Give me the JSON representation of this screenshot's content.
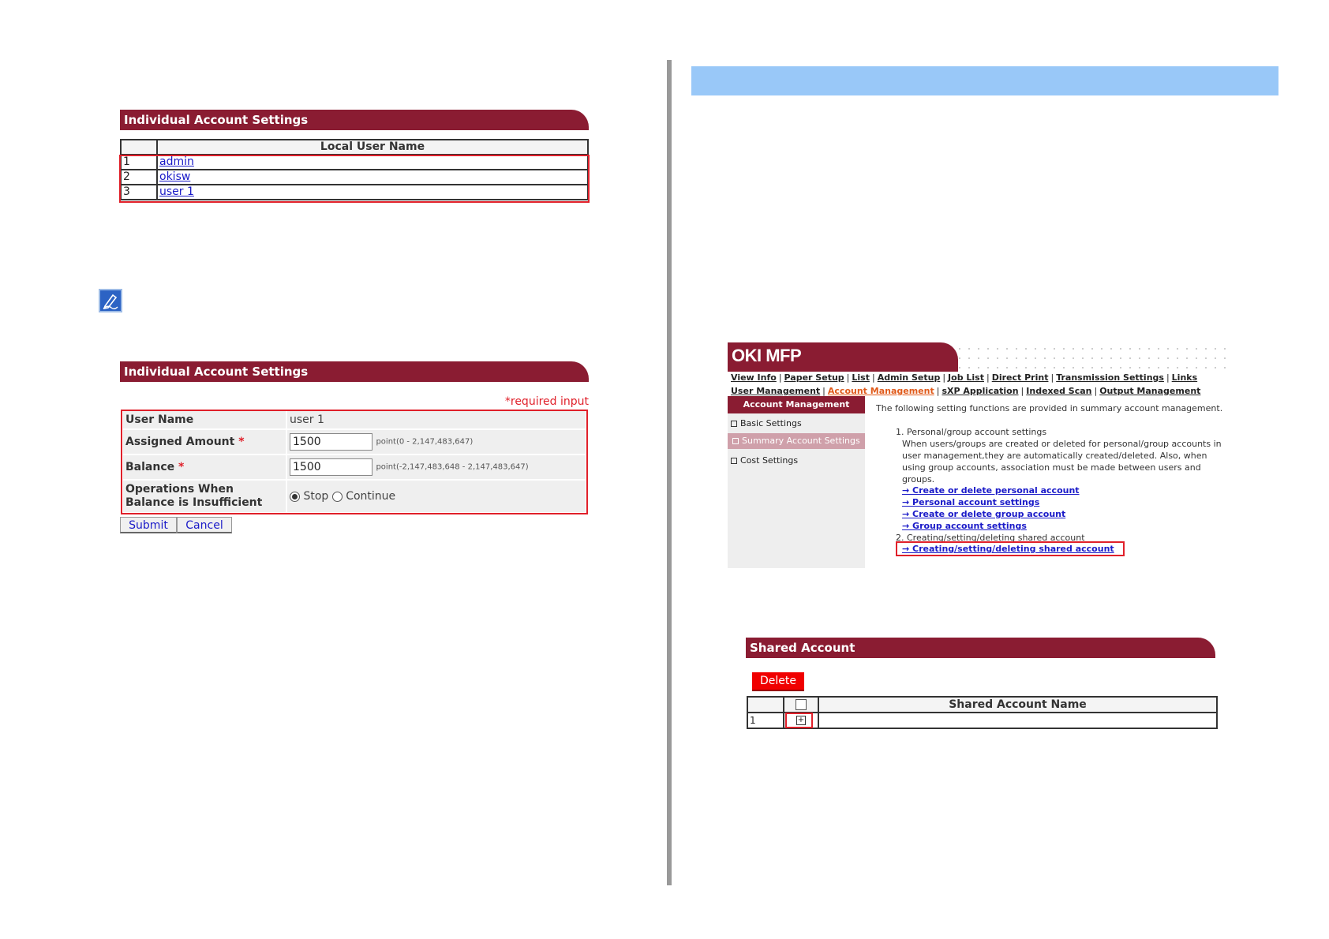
{
  "left": {
    "accounts_panel": {
      "title": "Individual Account Settings",
      "column_header": "Local User Name",
      "users": [
        {
          "num": "1",
          "name": "admin"
        },
        {
          "num": "2",
          "name": "okisw"
        },
        {
          "num": "3",
          "name": "user 1"
        }
      ]
    },
    "note_icon": "pen-note-icon",
    "form_panel": {
      "title": "Individual Account Settings",
      "required_note": "*required input",
      "user_name_label": "User Name",
      "user_name_value": "user 1",
      "assigned_label": "Assigned Amount",
      "assigned_value": "1500",
      "assigned_range": "point(0 - 2,147,483,647)",
      "balance_label": "Balance",
      "balance_value": "1500",
      "balance_range": "point(-2,147,483,648 - 2,147,483,647)",
      "operations_label_1": "Operations When",
      "operations_label_2": "Balance is Insufficient",
      "option_stop": "Stop",
      "option_continue": "Continue",
      "selected_option": "Stop",
      "required_mark": "*",
      "submit_label": "Submit",
      "cancel_label": "Cancel"
    }
  },
  "right": {
    "banner_color": "#99c8f8",
    "oki": {
      "brand": "OKI MFP",
      "nav_row1": [
        "View Info",
        "Paper Setup",
        "List",
        "Admin Setup",
        "Job List",
        "Direct Print",
        "Transmission Settings",
        "Links"
      ],
      "nav_row2": [
        "User Management",
        "Account Management",
        "sXP Application",
        "Indexed Scan",
        "Output Management"
      ],
      "current_nav": "Account Management",
      "sidebar_header": "Account Management",
      "sidebar_items": [
        "Basic Settings",
        "Summary Account Settings",
        "Cost Settings"
      ],
      "intro": "The following setting functions are provided in summary account management.",
      "item1_title": "1. Personal/group account settings",
      "item1_text": "When users/groups are created or deleted for personal/group accounts in user management,they are automatically created/deleted. Also, when using group accounts, association must be made between users and groups.",
      "links": [
        "→ Create or delete personal account",
        "→ Personal account settings",
        "→ Create or delete group account",
        "→ Group account settings"
      ],
      "item2_title": "2. Creating/setting/deleting shared account",
      "item2_link": "→ Creating/setting/deleting shared account"
    },
    "shared": {
      "title": "Shared Account",
      "delete_label": "Delete",
      "column_header": "Shared Account Name",
      "row_num": "1",
      "expand_icon": "plus-box-icon"
    }
  },
  "colors": {
    "header": "#8a1c32",
    "highlight": "#e0202a",
    "link": "#1a1ac8",
    "delete": "#f00000"
  }
}
